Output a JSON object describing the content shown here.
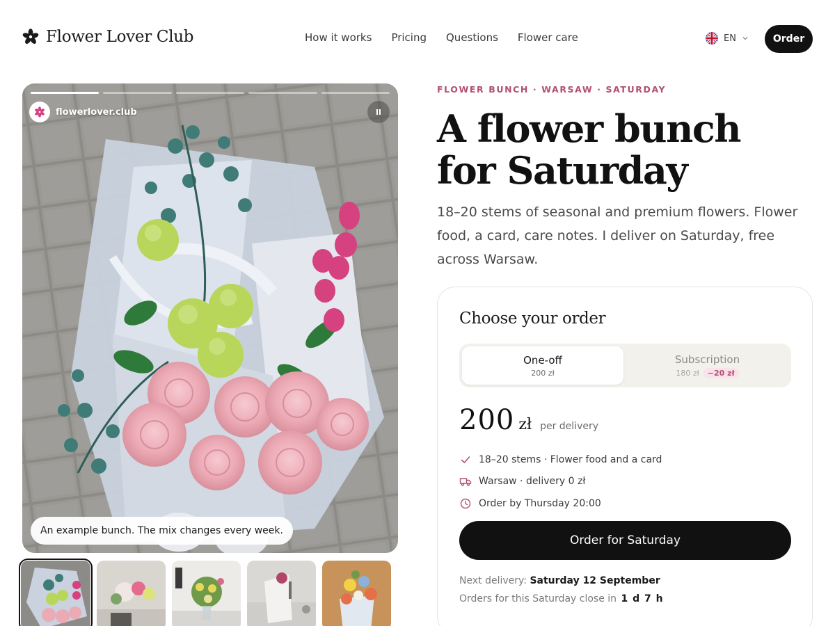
{
  "header": {
    "brand": "Flower Lover Club",
    "nav": [
      "How it works",
      "Pricing",
      "Questions",
      "Flower care"
    ],
    "language": "EN",
    "order_label": "Order"
  },
  "hero": {
    "handle": "flowerlover.club",
    "caption": "An example bunch. The mix changes every week.",
    "story_segments": 5,
    "story_progress": [
      1,
      0,
      0,
      0,
      0
    ],
    "icons": [
      "flower-logo-icon",
      "pause-icon"
    ]
  },
  "thumbnails": [
    {
      "name": "bunch-1",
      "active": true
    },
    {
      "name": "bunch-2",
      "active": false
    },
    {
      "name": "bunch-3",
      "active": false
    },
    {
      "name": "bunch-4",
      "active": false
    },
    {
      "name": "bunch-5",
      "active": false
    }
  ],
  "product": {
    "eyebrow": "FLOWER BUNCH · WARSAW · SATURDAY",
    "title_line1": "A flower bunch",
    "title_line2": "for Saturday",
    "description": "18–20 stems of seasonal and premium flowers. Flower food, a card, care notes. I deliver on Saturday, free across Warsaw."
  },
  "order_card": {
    "title": "Choose your order",
    "options": [
      {
        "label": "One-off",
        "price": "200 zł",
        "selected": true
      },
      {
        "label": "Subscription",
        "price": "180 zł",
        "discount": "−20 zł",
        "selected": false
      }
    ],
    "price": "200",
    "currency": "zł",
    "per": "per delivery",
    "features": [
      {
        "icon": "check-icon",
        "text": "18–20 stems · Flower food and a card"
      },
      {
        "icon": "truck-icon",
        "text": "Warsaw · delivery 0 zł"
      },
      {
        "icon": "clock-icon",
        "text": "Order by Thursday 20:00"
      }
    ],
    "cta": "Order for Saturday",
    "next_label": "Next delivery:",
    "next_value": "Saturday 12 September",
    "close_label": "Orders for this Saturday close in",
    "close_value": "1 d 7 h"
  },
  "colors": {
    "accent": "#b14f73",
    "dark": "#111111",
    "muted_bg": "#f3f1ec"
  }
}
